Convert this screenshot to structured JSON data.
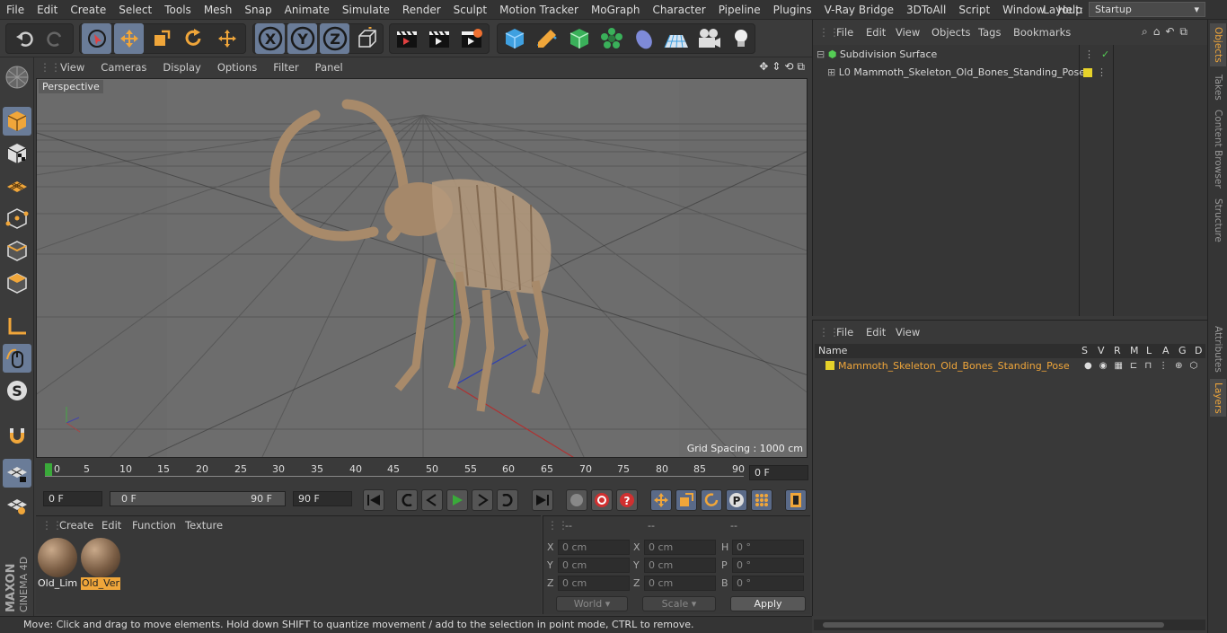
{
  "menu": [
    "File",
    "Edit",
    "Create",
    "Select",
    "Tools",
    "Mesh",
    "Snap",
    "Animate",
    "Simulate",
    "Render",
    "Sculpt",
    "Motion Tracker",
    "MoGraph",
    "Character",
    "Pipeline",
    "Plugins",
    "V-Ray Bridge",
    "3DToAll",
    "Script",
    "Window",
    "Help"
  ],
  "layout": {
    "label": "Layout:",
    "value": "Startup"
  },
  "viewport": {
    "menu": [
      "View",
      "Cameras",
      "Display",
      "Options",
      "Filter",
      "Panel"
    ],
    "label": "Perspective",
    "grid_spacing": "Grid Spacing : 1000 cm"
  },
  "timeline": {
    "ticks": [
      "0",
      "5",
      "10",
      "15",
      "20",
      "25",
      "30",
      "35",
      "40",
      "45",
      "50",
      "55",
      "60",
      "65",
      "70",
      "75",
      "80",
      "85",
      "90"
    ],
    "current": "0 F"
  },
  "controls": {
    "start": "0 F",
    "range_start": "0 F",
    "range_end": "90 F",
    "end": "90 F"
  },
  "material_manager": {
    "menu": [
      "Create",
      "Edit",
      "Function",
      "Texture"
    ],
    "materials": [
      {
        "name": "Old_Lim",
        "selected": false
      },
      {
        "name": "Old_Ver",
        "selected": true
      }
    ]
  },
  "coordinates": {
    "headers": [
      "--",
      "--",
      "--"
    ],
    "rows": [
      [
        "X",
        "0 cm",
        "X",
        "0 cm",
        "H",
        "0 °"
      ],
      [
        "Y",
        "0 cm",
        "Y",
        "0 cm",
        "P",
        "0 °"
      ],
      [
        "Z",
        "0 cm",
        "Z",
        "0 cm",
        "B",
        "0 °"
      ]
    ],
    "world": "World",
    "scale": "Scale",
    "apply": "Apply"
  },
  "status": "Move: Click and drag to move elements. Hold down SHIFT to quantize movement / add to the selection in point mode, CTRL to remove.",
  "object_manager": {
    "menu": [
      "File",
      "Edit",
      "View",
      "Objects",
      "Tags",
      "Bookmarks"
    ],
    "objects": [
      "Subdivision Surface",
      "Mammoth_Skeleton_Old_Bones_Standing_Pose"
    ]
  },
  "layer_manager": {
    "menu": [
      "File",
      "Edit",
      "View"
    ],
    "columns": [
      "Name",
      "S",
      "V",
      "R",
      "M",
      "L",
      "A",
      "G",
      "D"
    ],
    "layers": [
      "Mammoth_Skeleton_Old_Bones_Standing_Pose"
    ]
  },
  "side_tabs": [
    "Objects",
    "Takes",
    "Content Browser",
    "Structure",
    "Attributes",
    "Layers"
  ],
  "branding": {
    "maxon": "MAXON",
    "cinema": "CINEMA 4D"
  },
  "colors": {
    "accent": "#f0a63a",
    "selected": "#6a7c98",
    "layer_yellow": "#e6d22a"
  }
}
